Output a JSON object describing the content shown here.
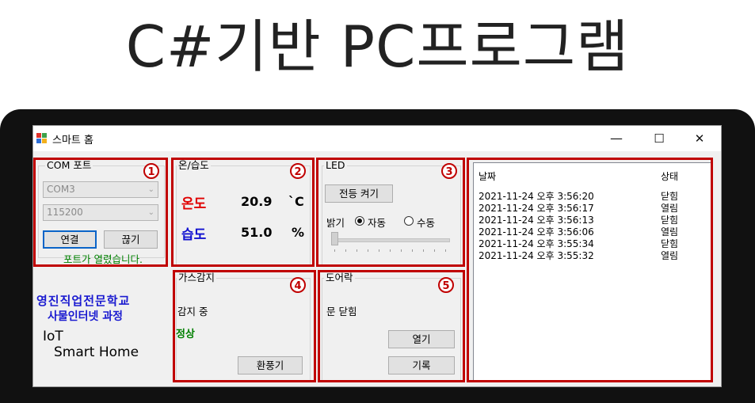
{
  "slide_title": "C#기반 PC프로그램",
  "window": {
    "title": "스마트 홈",
    "minimize": "—",
    "maximize": "☐",
    "close": "✕"
  },
  "com": {
    "label": "COM 포트",
    "port": "COM3",
    "baud": "115200",
    "connect": "연결",
    "disconnect": "끊기",
    "status": "포트가 열렸습니다."
  },
  "temp": {
    "label": "온/습도",
    "temp_label": "온도",
    "temp_value": "20.9",
    "temp_unit": "`C",
    "hum_label": "습도",
    "hum_value": "51.0",
    "hum_unit": "%"
  },
  "led": {
    "label": "LED",
    "button": "전등 켜기",
    "brightness_label": "밝기",
    "auto": "자동",
    "manual": "수동",
    "mode": "auto",
    "slider_level": 0
  },
  "gas": {
    "label": "가스감지",
    "status": "감지 중",
    "value": "정상",
    "button": "환풍기"
  },
  "door": {
    "label": "도어락",
    "status": "문 닫힘",
    "open_button": "열기",
    "log_button": "기록"
  },
  "log": {
    "col_date": "날짜",
    "col_state": "상태",
    "rows": [
      {
        "date": "2021-11-24 오후 3:56:20",
        "state": "닫힘"
      },
      {
        "date": "2021-11-24 오후 3:56:17",
        "state": "열림"
      },
      {
        "date": "2021-11-24 오후 3:56:13",
        "state": "닫힘"
      },
      {
        "date": "2021-11-24 오후 3:56:06",
        "state": "열림"
      },
      {
        "date": "2021-11-24 오후 3:55:34",
        "state": "닫힘"
      },
      {
        "date": "2021-11-24 오후 3:55:32",
        "state": "열림"
      }
    ]
  },
  "school": {
    "name": "영진직업전문학교",
    "course": "사물인터넷 과정",
    "iot": "IoT",
    "smart_home": "Smart Home"
  },
  "badges": [
    "1",
    "2",
    "3",
    "4",
    "5"
  ],
  "colors": {
    "annotation": "#c00000",
    "temp_label": "#e00000",
    "hum_label": "#1010d0",
    "status_ok": "#008000",
    "school": "#1a1ad0"
  }
}
